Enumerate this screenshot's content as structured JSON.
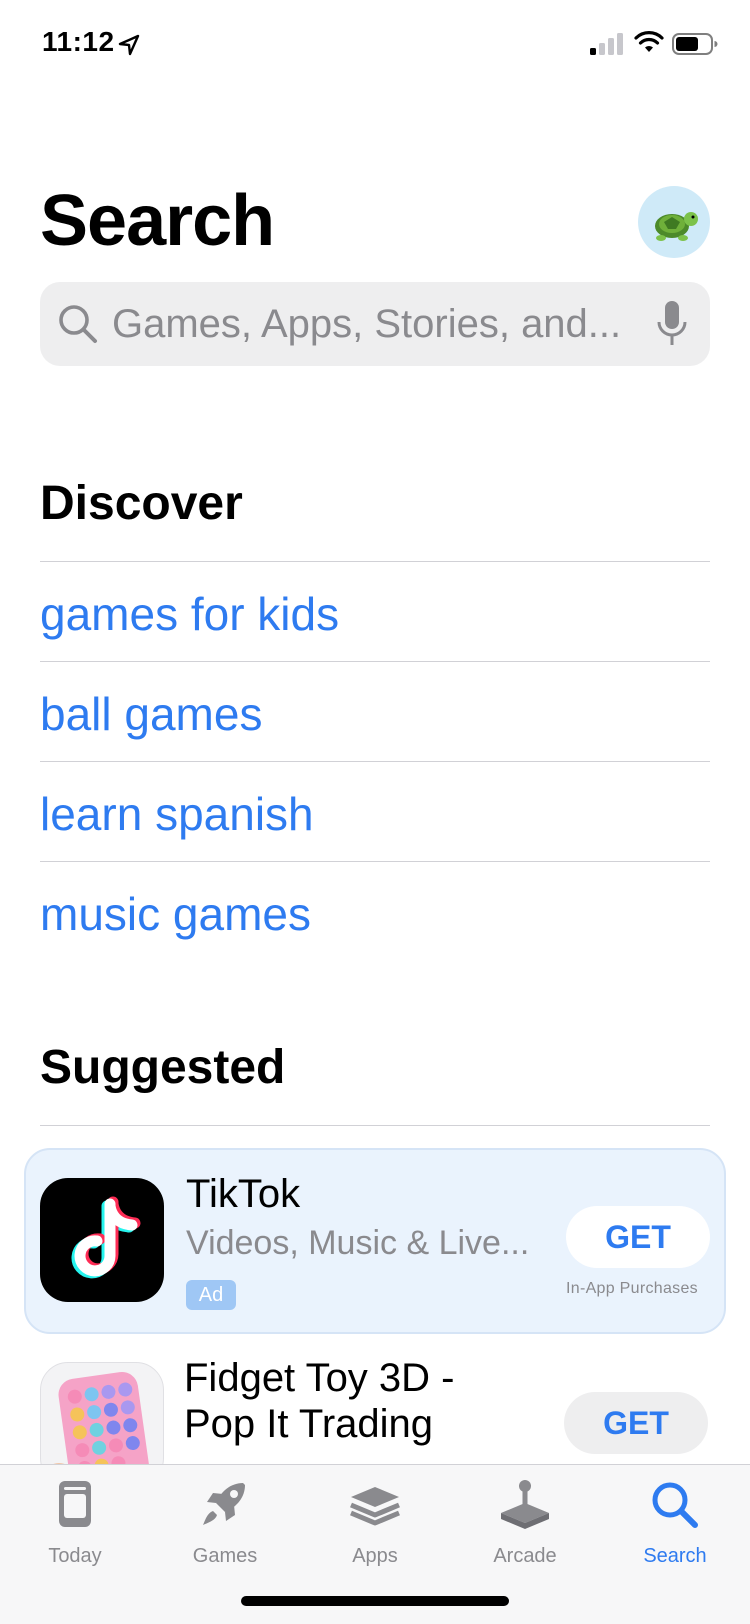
{
  "status_bar": {
    "time": "11:12"
  },
  "header": {
    "title": "Search"
  },
  "search": {
    "placeholder": "Games, Apps, Stories, and..."
  },
  "discover": {
    "heading": "Discover",
    "items": [
      "games for kids",
      "ball games",
      "learn spanish",
      "music games"
    ]
  },
  "suggested": {
    "heading": "Suggested",
    "apps": [
      {
        "title": "TikTok",
        "subtitle": "Videos, Music & Live...",
        "badge": "Ad",
        "button": "GET",
        "note": "In-App Purchases"
      },
      {
        "title_line1": "Fidget Toy 3D -",
        "title_line2": "Pop It Trading",
        "button": "GET"
      }
    ]
  },
  "tabs": [
    {
      "label": "Today",
      "icon": "today-icon"
    },
    {
      "label": "Games",
      "icon": "rocket-icon"
    },
    {
      "label": "Apps",
      "icon": "apps-stack-icon"
    },
    {
      "label": "Arcade",
      "icon": "joystick-icon"
    },
    {
      "label": "Search",
      "icon": "search-icon",
      "active": true
    }
  ],
  "colors": {
    "accent": "#2e7bf0",
    "ad_card": "#eaf3fd",
    "secondary_text": "#8a8a8e"
  }
}
